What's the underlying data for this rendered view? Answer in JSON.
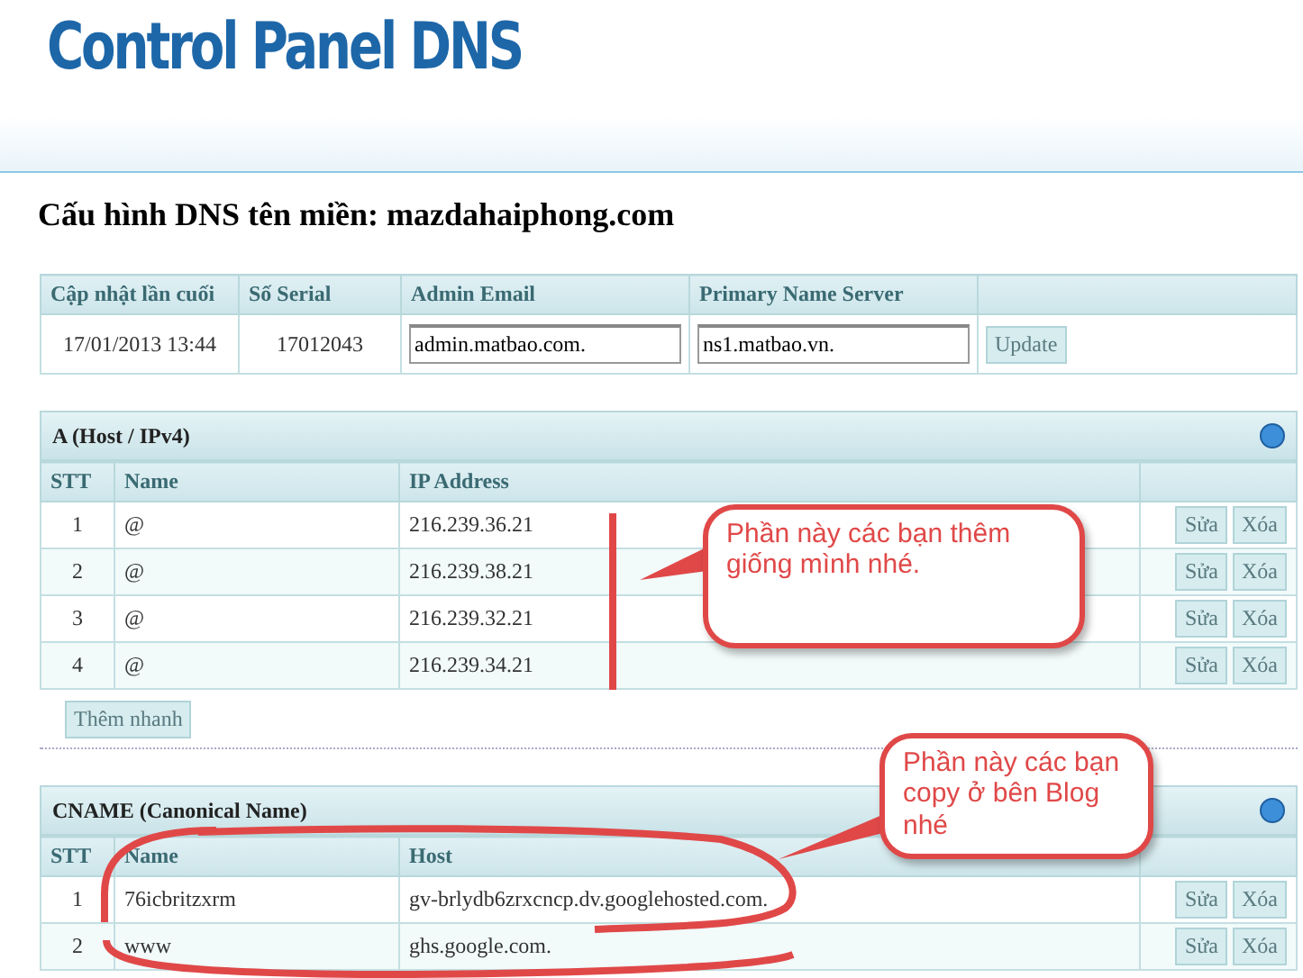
{
  "header": {
    "logo": "Control Panel DNS"
  },
  "page_title": "Cấu hình DNS tên miền: mazdahaiphong.com",
  "info": {
    "columns": [
      "Cập nhật lần cuối",
      "Số Serial",
      "Admin Email",
      "Primary Name Server"
    ],
    "last_updated": "17/01/2013 13:44",
    "serial": "17012043",
    "admin_email": "admin.matbao.com.",
    "primary_ns": "ns1.matbao.vn.",
    "button": "Update"
  },
  "sections": [
    {
      "title": "A (Host / IPv4)",
      "columns": [
        "STT",
        "Name",
        "IP Address"
      ],
      "rows": [
        {
          "stt": "1",
          "name": "@",
          "value": "216.239.36.21",
          "edit": "Sửa",
          "delete": "Xóa"
        },
        {
          "stt": "2",
          "name": "@",
          "value": "216.239.38.21",
          "edit": "Sửa",
          "delete": "Xóa"
        },
        {
          "stt": "3",
          "name": "@",
          "value": "216.239.32.21",
          "edit": "Sửa",
          "delete": "Xóa"
        },
        {
          "stt": "4",
          "name": "@",
          "value": "216.239.34.21",
          "edit": "Sửa",
          "delete": "Xóa"
        }
      ],
      "quick_add": "Thêm nhanh"
    },
    {
      "title": "CNAME (Canonical Name)",
      "columns": [
        "STT",
        "Name",
        "Host"
      ],
      "rows": [
        {
          "stt": "1",
          "name": "76icbritzxrm",
          "value": "gv-brlydb6zrxcncp.dv.googlehosted.com.",
          "edit": "Sửa",
          "delete": "Xóa"
        },
        {
          "stt": "2",
          "name": "www",
          "value": "ghs.google.com.",
          "edit": "Sửa",
          "delete": "Xóa"
        }
      ]
    }
  ],
  "annotations": [
    {
      "text": "Phần này các bạn thêm giống mình nhé."
    },
    {
      "text": "Phần này các bạn copy ở bên Blog nhé"
    }
  ]
}
